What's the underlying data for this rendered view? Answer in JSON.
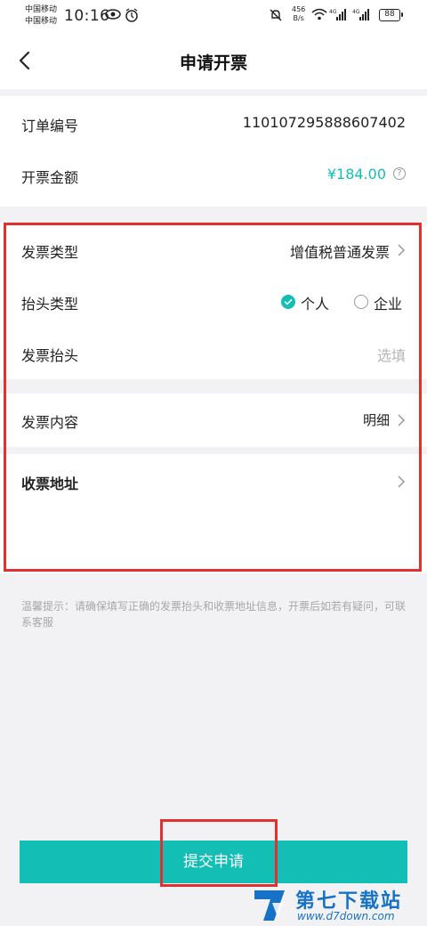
{
  "status_bar": {
    "carrier_1": "中国移动",
    "carrier_2": "中国移动",
    "time": "10:16",
    "net_speed_value": "456",
    "net_speed_unit": "B/s",
    "battery": "88"
  },
  "header": {
    "title": "申请开票"
  },
  "order": {
    "number_label": "订单编号",
    "number_value": "110107295888607402",
    "amount_label": "开票金额",
    "amount_value": "¥184.00"
  },
  "invoice": {
    "type_label": "发票类型",
    "type_value": "增值税普通发票",
    "title_type_label": "抬头类型",
    "title_type_options": [
      "个人",
      "企业"
    ],
    "title_type_selected": "个人",
    "title_label": "发票抬头",
    "title_placeholder": "选填",
    "content_label": "发票内容",
    "content_value": "明细",
    "address_label": "收票地址"
  },
  "tip": "温馨提示：请确保填写正确的发票抬头和收票地址信息，开票后如若有疑问，可联系客服",
  "submit_label": "提交申请",
  "watermark": {
    "title": "第七下载站",
    "url": "www.d7down.com"
  },
  "colors": {
    "accent": "#13bfb5",
    "highlight": "#e03030",
    "watermark": "#1572c6"
  }
}
